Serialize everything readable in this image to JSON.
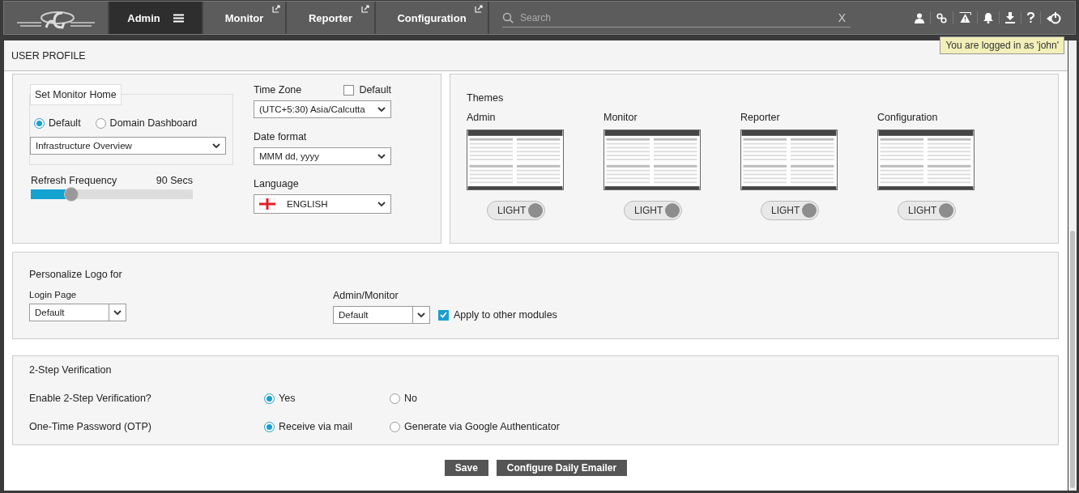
{
  "nav": {
    "tabs": [
      {
        "label": "Admin",
        "selected": true,
        "external": false,
        "menu": true
      },
      {
        "label": "Monitor",
        "selected": false,
        "external": true,
        "menu": false
      },
      {
        "label": "Reporter",
        "selected": false,
        "external": true,
        "menu": false
      },
      {
        "label": "Configuration",
        "selected": false,
        "external": true,
        "menu": false
      }
    ],
    "search": {
      "placeholder": "Search",
      "clear": "X"
    },
    "tooltip": "You are logged in as 'john'"
  },
  "page_title": "USER PROFILE",
  "monitor_home": {
    "legend": "Set Monitor Home",
    "options": [
      {
        "label": "Default",
        "selected": true
      },
      {
        "label": "Domain Dashboard",
        "selected": false
      }
    ],
    "dashboard": "Infrastructure Overview"
  },
  "refresh": {
    "label": "Refresh Frequency",
    "reading": "90 Secs",
    "level": 0.25
  },
  "time_zone": {
    "label": "Time Zone",
    "default_label": "Default",
    "default_checked": false,
    "value": "(UTC+5:30) Asia/Calcutta"
  },
  "date_format": {
    "label": "Date format",
    "value": "MMM dd, yyyy"
  },
  "language": {
    "label": "Language",
    "value": "ENGLISH"
  },
  "themes": {
    "title": "Themes",
    "items": [
      {
        "name": "Admin",
        "toggle": "LIGHT",
        "on": true
      },
      {
        "name": "Monitor",
        "toggle": "LIGHT",
        "on": true
      },
      {
        "name": "Reporter",
        "toggle": "LIGHT",
        "on": true
      },
      {
        "name": "Configuration",
        "toggle": "LIGHT",
        "on": true
      }
    ]
  },
  "logo": {
    "title": "Personalize Logo for",
    "login": {
      "label": "Login Page",
      "value": "Default"
    },
    "admin": {
      "label": "Admin/Monitor",
      "value": "Default"
    },
    "apply": {
      "label": "Apply to other modules",
      "checked": true
    }
  },
  "two_step": {
    "title": "2-Step Verification",
    "rows": [
      {
        "label": "Enable 2-Step Verification?",
        "options": [
          {
            "label": "Yes",
            "selected": true
          },
          {
            "label": "No",
            "selected": false
          }
        ]
      },
      {
        "label": "One-Time Password (OTP)",
        "options": [
          {
            "label": "Receive via mail",
            "selected": true
          },
          {
            "label": "Generate via Google Authenticator",
            "selected": false
          }
        ]
      }
    ]
  },
  "buttons": [
    "Save",
    "Configure Daily Emailer"
  ]
}
